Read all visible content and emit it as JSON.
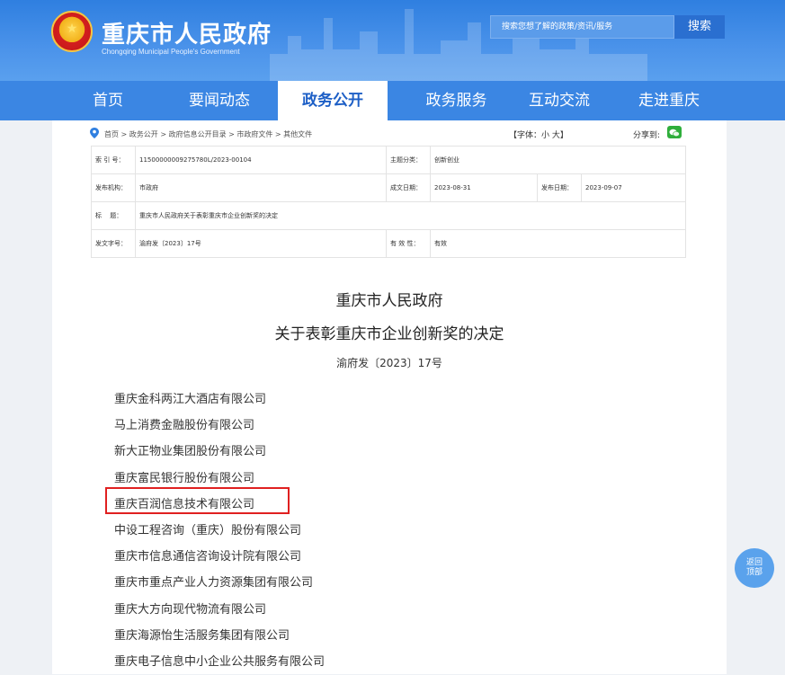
{
  "header": {
    "title": "重庆市人民政府",
    "subtitle": "Chongqing Municipal People's Government",
    "search_placeholder": "搜索您想了解的政策/资讯/服务",
    "search_button": "搜索"
  },
  "nav": {
    "items": [
      {
        "label": "首页",
        "active": false
      },
      {
        "label": "要闻动态",
        "active": false
      },
      {
        "label": "政务公开",
        "active": true
      },
      {
        "label": "政务服务",
        "active": false
      },
      {
        "label": "互动交流",
        "active": false
      },
      {
        "label": "走进重庆",
        "active": false
      }
    ]
  },
  "breadcrumb": {
    "text": "首页 > 政务公开 > 政府信息公开目录 > 市政府文件 > 其他文件",
    "font_size_label": "【字体：小 大】",
    "share_label": "分享到:"
  },
  "meta": {
    "index_label": "索 引 号：",
    "index_value": "11500000009275780L/2023-00104",
    "topic_label": "主题分类：",
    "topic_value": "创新创业",
    "issuer_label": "发布机构：",
    "issuer_value": "市政府",
    "created_label": "成文日期：",
    "created_value": "2023-08-31",
    "published_label": "发布日期：",
    "published_value": "2023-09-07",
    "title_label": "标　 题：",
    "title_value": "重庆市人民政府关于表彰重庆市企业创新奖的决定",
    "docno_label": "发文字号：",
    "docno_value": "渝府发〔2023〕17号",
    "validity_label": "有 效 性：",
    "validity_value": "有效"
  },
  "document": {
    "org": "重庆市人民政府",
    "title": "关于表彰重庆市企业创新奖的决定",
    "number": "渝府发〔2023〕17号",
    "companies": [
      "重庆金科两江大酒店有限公司",
      "马上消费金融股份有限公司",
      "新大正物业集团股份有限公司",
      "重庆富民银行股份有限公司",
      "重庆百润信息技术有限公司",
      "中设工程咨询（重庆）股份有限公司",
      "重庆市信息通信咨询设计院有限公司",
      "重庆市重点产业人力资源集团有限公司",
      "重庆大方向现代物流有限公司",
      "重庆海源怡生活服务集团有限公司",
      "重庆电子信息中小企业公共服务有限公司"
    ]
  },
  "back_to_top": {
    "line1": "返回",
    "line2": "顶部"
  },
  "colors": {
    "header_blue": "#3b86e3",
    "highlight_red": "#e02020",
    "wechat_green": "#2fae3b"
  },
  "icons": [
    "national-emblem-icon",
    "location-pin-icon",
    "wechat-icon"
  ]
}
